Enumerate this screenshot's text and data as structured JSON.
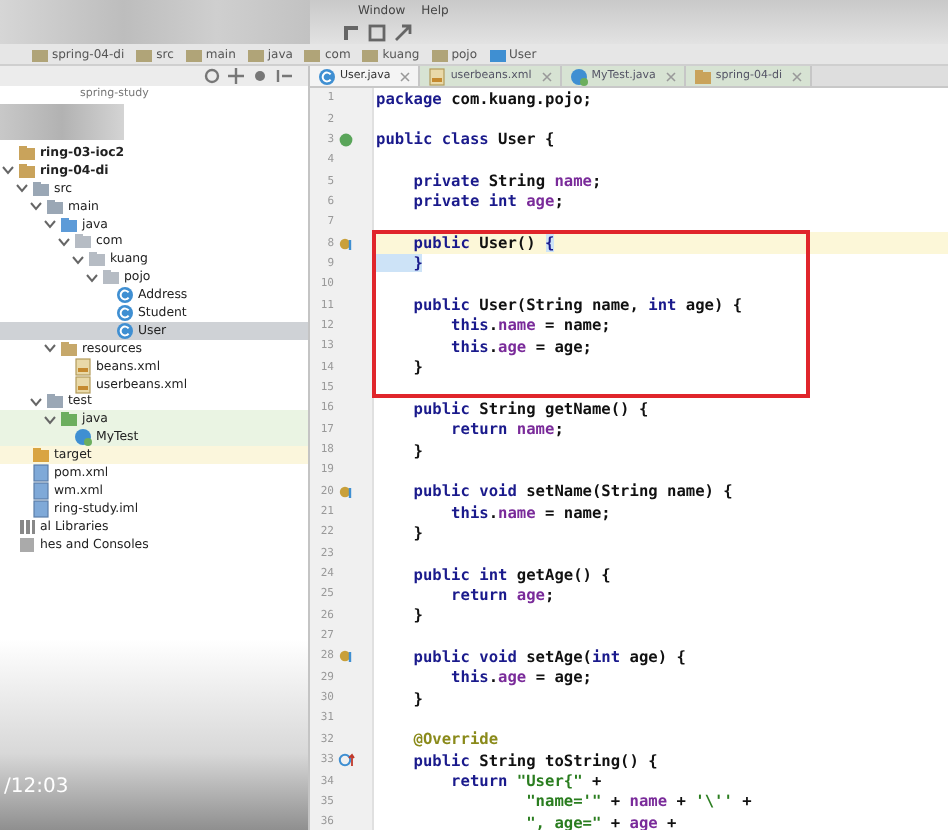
{
  "menu": {
    "items": [
      "Window",
      "Help"
    ]
  },
  "breadcrumbs": [
    "spring-04-di",
    "src",
    "main",
    "java",
    "com",
    "kuang",
    "pojo",
    "User"
  ],
  "project": {
    "path": "spring-study",
    "tree": [
      {
        "label": "ring-03-ioc2",
        "kind": "module",
        "selected": false
      },
      {
        "label": "ring-04-di",
        "kind": "module",
        "selected": false,
        "expanded": true,
        "children": [
          {
            "label": "src",
            "kind": "folder",
            "selected": false,
            "expanded": true,
            "children": [
              {
                "label": "main",
                "kind": "folder",
                "selected": false,
                "expanded": true,
                "children": [
                  {
                    "label": "java",
                    "kind": "source",
                    "selected": false,
                    "expanded": true,
                    "children": [
                      {
                        "label": "com",
                        "kind": "package",
                        "selected": false,
                        "expanded": true,
                        "children": [
                          {
                            "label": "kuang",
                            "kind": "package",
                            "selected": false,
                            "expanded": true,
                            "children": [
                              {
                                "label": "pojo",
                                "kind": "package",
                                "selected": false,
                                "expanded": true,
                                "children": [
                                  {
                                    "label": "Address",
                                    "kind": "class",
                                    "selected": false
                                  },
                                  {
                                    "label": "Student",
                                    "kind": "class",
                                    "selected": false
                                  },
                                  {
                                    "label": "User",
                                    "kind": "class",
                                    "selected": true
                                  }
                                ]
                              }
                            ]
                          }
                        ]
                      }
                    ]
                  },
                  {
                    "label": "resources",
                    "kind": "resources",
                    "selected": false,
                    "expanded": true,
                    "children": [
                      {
                        "label": "beans.xml",
                        "kind": "xml",
                        "selected": false
                      },
                      {
                        "label": "userbeans.xml",
                        "kind": "xml",
                        "selected": false
                      }
                    ]
                  }
                ]
              },
              {
                "label": "test",
                "kind": "folder",
                "selected": false,
                "expanded": true,
                "children": [
                  {
                    "label": "java",
                    "kind": "test",
                    "selected": false,
                    "expanded": true,
                    "children": [
                      {
                        "label": "MyTest",
                        "kind": "testclass",
                        "selected": false
                      }
                    ]
                  }
                ]
              }
            ]
          },
          {
            "label": "target",
            "kind": "excluded",
            "selected": false
          },
          {
            "label": "pom.xml",
            "kind": "file",
            "selected": false
          },
          {
            "label": "wm.xml",
            "kind": "file",
            "selected": false
          },
          {
            "label": "ring-study.iml",
            "kind": "file",
            "selected": false
          }
        ]
      },
      {
        "label": "al Libraries",
        "kind": "libraries",
        "selected": false
      },
      {
        "label": "hes and Consoles",
        "kind": "scratches",
        "selected": false
      }
    ]
  },
  "tabs": [
    {
      "label": "User.java",
      "kind": "class",
      "selected": true
    },
    {
      "label": "userbeans.xml",
      "kind": "xml",
      "selected": false
    },
    {
      "label": "MyTest.java",
      "kind": "testclass",
      "selected": false
    },
    {
      "label": "spring-04-di",
      "kind": "module",
      "selected": false
    }
  ],
  "editor": {
    "lines": [
      {
        "number": "1",
        "current": false,
        "tokens": [
          {
            "kind": "kw",
            "text": "package "
          },
          {
            "kind": "text",
            "text": "com.kuang.pojo;"
          }
        ]
      },
      {
        "number": "2"
      },
      {
        "number": "3",
        "marker": {
          "kind": "class"
        },
        "current": false,
        "tokens": [
          {
            "kind": "kw",
            "text": "public class "
          },
          {
            "kind": "text",
            "text": "User {"
          }
        ]
      },
      {
        "number": "4"
      },
      {
        "number": "5",
        "current": false,
        "tokens": [
          {
            "kind": "kw",
            "text": "    private "
          },
          {
            "kind": "text",
            "text": "String "
          },
          {
            "kind": "field",
            "text": "name"
          },
          {
            "kind": "text",
            "text": ";"
          }
        ]
      },
      {
        "number": "6",
        "current": false,
        "tokens": [
          {
            "kind": "kw",
            "text": "    private int "
          },
          {
            "kind": "field",
            "text": "age"
          },
          {
            "kind": "text",
            "text": ";"
          }
        ]
      },
      {
        "number": "7"
      },
      {
        "number": "8",
        "marker": {
          "kind": "method"
        },
        "current": true,
        "tokens": [
          {
            "kind": "kw",
            "text": "    public "
          },
          {
            "kind": "text",
            "text": "User() "
          },
          {
            "kind": "brace",
            "text": "{"
          }
        ]
      },
      {
        "number": "9",
        "current": false,
        "tokens": [
          {
            "kind": "brace",
            "text": "    }"
          }
        ]
      },
      {
        "number": "10"
      },
      {
        "number": "11",
        "current": false,
        "tokens": [
          {
            "kind": "kw",
            "text": "    public "
          },
          {
            "kind": "text",
            "text": "User(String name, "
          },
          {
            "kind": "kw",
            "text": "int "
          },
          {
            "kind": "text",
            "text": "age) {"
          }
        ]
      },
      {
        "number": "12",
        "current": false,
        "tokens": [
          {
            "kind": "kw",
            "text": "        this"
          },
          {
            "kind": "text",
            "text": "."
          },
          {
            "kind": "field",
            "text": "name"
          },
          {
            "kind": "text",
            "text": " = name;"
          }
        ]
      },
      {
        "number": "13",
        "current": false,
        "tokens": [
          {
            "kind": "kw",
            "text": "        this"
          },
          {
            "kind": "text",
            "text": "."
          },
          {
            "kind": "field",
            "text": "age"
          },
          {
            "kind": "text",
            "text": " = age;"
          }
        ]
      },
      {
        "number": "14",
        "current": false,
        "tokens": [
          {
            "kind": "text",
            "text": "    }"
          }
        ]
      },
      {
        "number": "15"
      },
      {
        "number": "16",
        "current": false,
        "tokens": [
          {
            "kind": "kw",
            "text": "    public "
          },
          {
            "kind": "text",
            "text": "String getName() {"
          }
        ]
      },
      {
        "number": "17",
        "current": false,
        "tokens": [
          {
            "kind": "kw",
            "text": "        return "
          },
          {
            "kind": "field",
            "text": "name"
          },
          {
            "kind": "text",
            "text": ";"
          }
        ]
      },
      {
        "number": "18",
        "current": false,
        "tokens": [
          {
            "kind": "text",
            "text": "    }"
          }
        ]
      },
      {
        "number": "19"
      },
      {
        "number": "20",
        "marker": {
          "kind": "method"
        },
        "current": false,
        "tokens": [
          {
            "kind": "kw",
            "text": "    public void "
          },
          {
            "kind": "text",
            "text": "setName(String name) {"
          }
        ]
      },
      {
        "number": "21",
        "current": false,
        "tokens": [
          {
            "kind": "kw",
            "text": "        this"
          },
          {
            "kind": "text",
            "text": "."
          },
          {
            "kind": "field",
            "text": "name"
          },
          {
            "kind": "text",
            "text": " = name;"
          }
        ]
      },
      {
        "number": "22",
        "current": false,
        "tokens": [
          {
            "kind": "text",
            "text": "    }"
          }
        ]
      },
      {
        "number": "23"
      },
      {
        "number": "24",
        "current": false,
        "tokens": [
          {
            "kind": "kw",
            "text": "    public int "
          },
          {
            "kind": "text",
            "text": "getAge() {"
          }
        ]
      },
      {
        "number": "25",
        "current": false,
        "tokens": [
          {
            "kind": "kw",
            "text": "        return "
          },
          {
            "kind": "field",
            "text": "age"
          },
          {
            "kind": "text",
            "text": ";"
          }
        ]
      },
      {
        "number": "26",
        "current": false,
        "tokens": [
          {
            "kind": "text",
            "text": "    }"
          }
        ]
      },
      {
        "number": "27"
      },
      {
        "number": "28",
        "marker": {
          "kind": "method"
        },
        "current": false,
        "tokens": [
          {
            "kind": "kw",
            "text": "    public void "
          },
          {
            "kind": "text",
            "text": "setAge("
          },
          {
            "kind": "kw",
            "text": "int "
          },
          {
            "kind": "text",
            "text": "age) {"
          }
        ]
      },
      {
        "number": "29",
        "current": false,
        "tokens": [
          {
            "kind": "kw",
            "text": "        this"
          },
          {
            "kind": "text",
            "text": "."
          },
          {
            "kind": "field",
            "text": "age"
          },
          {
            "kind": "text",
            "text": " = age;"
          }
        ]
      },
      {
        "number": "30",
        "current": false,
        "tokens": [
          {
            "kind": "text",
            "text": "    }"
          }
        ]
      },
      {
        "number": "31"
      },
      {
        "number": "32",
        "current": false,
        "tokens": [
          {
            "kind": "ann",
            "text": "    @Override"
          }
        ]
      },
      {
        "number": "33",
        "marker": {
          "kind": "override"
        },
        "current": false,
        "tokens": [
          {
            "kind": "kw",
            "text": "    public "
          },
          {
            "kind": "text",
            "text": "String toString() {"
          }
        ]
      },
      {
        "number": "34",
        "current": false,
        "tokens": [
          {
            "kind": "kw",
            "text": "        return "
          },
          {
            "kind": "str",
            "text": "\"User{\""
          },
          {
            "kind": "text",
            "text": " +"
          }
        ]
      },
      {
        "number": "35",
        "current": false,
        "tokens": [
          {
            "kind": "str",
            "text": "                \"name='\""
          },
          {
            "kind": "text",
            "text": " + "
          },
          {
            "kind": "field",
            "text": "name"
          },
          {
            "kind": "text",
            "text": " + "
          },
          {
            "kind": "str",
            "text": "'\\''"
          },
          {
            "kind": "text",
            "text": " +"
          }
        ]
      },
      {
        "number": "36",
        "current": false,
        "tokens": [
          {
            "kind": "str",
            "text": "                \", age=\""
          },
          {
            "kind": "text",
            "text": " + "
          },
          {
            "kind": "field",
            "text": "age"
          },
          {
            "kind": "text",
            "text": " +"
          }
        ]
      }
    ]
  },
  "overlay": {
    "timestamp": "/12:03"
  }
}
